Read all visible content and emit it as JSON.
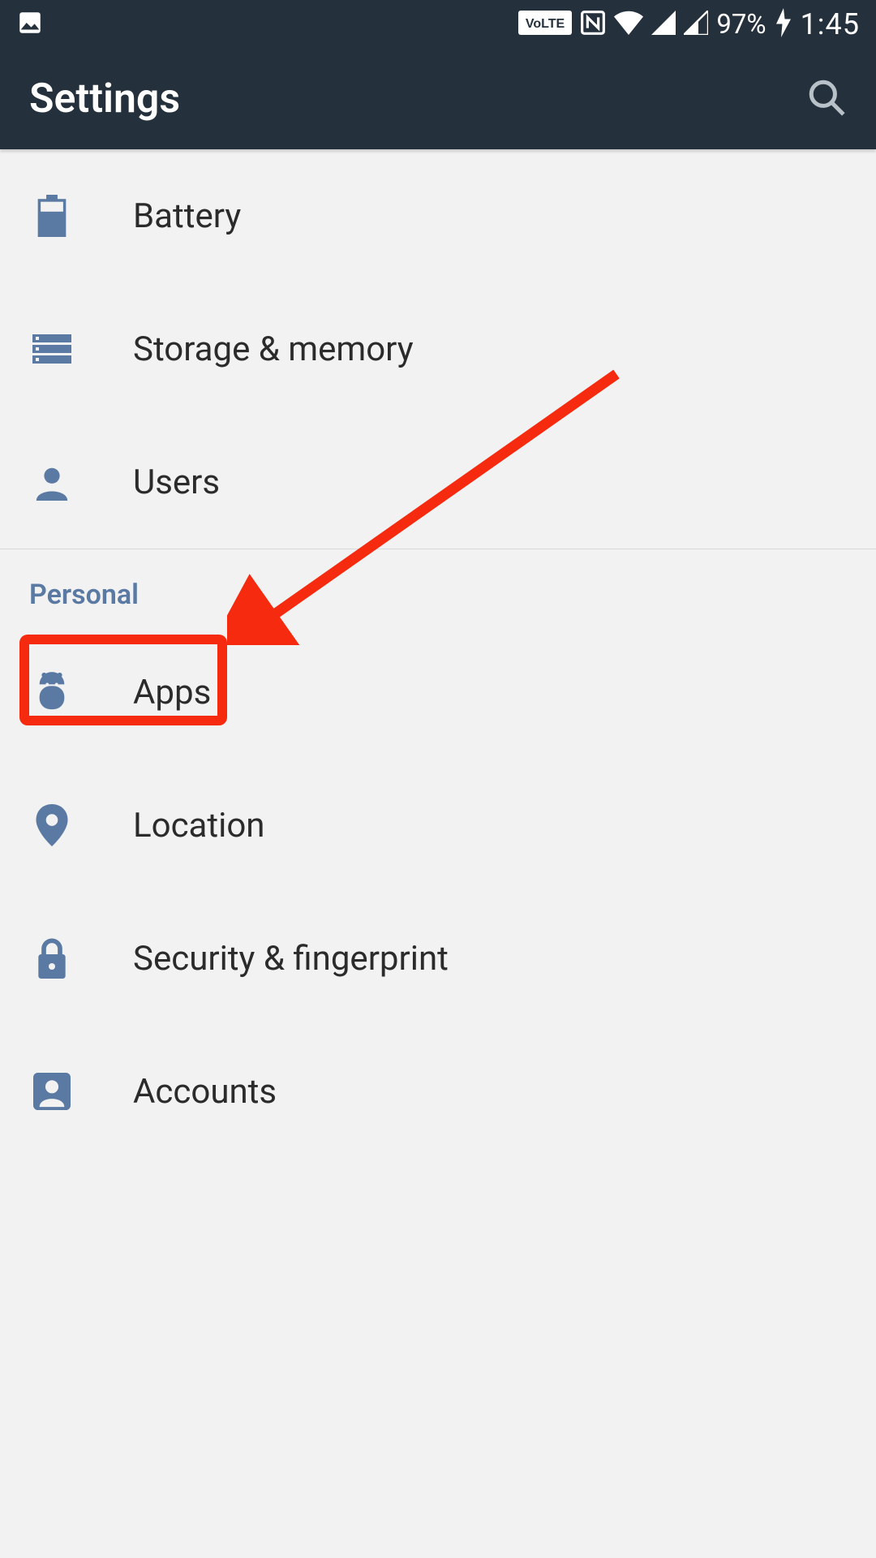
{
  "status_bar": {
    "battery_pct": "97%",
    "clock": "1:45",
    "volte_label": "VoLTE"
  },
  "app_bar": {
    "title": "Settings"
  },
  "sections": {
    "personal_header": "Personal"
  },
  "rows": {
    "battery": "Battery",
    "storage": "Storage & memory",
    "users": "Users",
    "apps": "Apps",
    "location": "Location",
    "security": "Security & fingerprint",
    "accounts": "Accounts"
  },
  "annotation": {
    "target": "apps"
  }
}
